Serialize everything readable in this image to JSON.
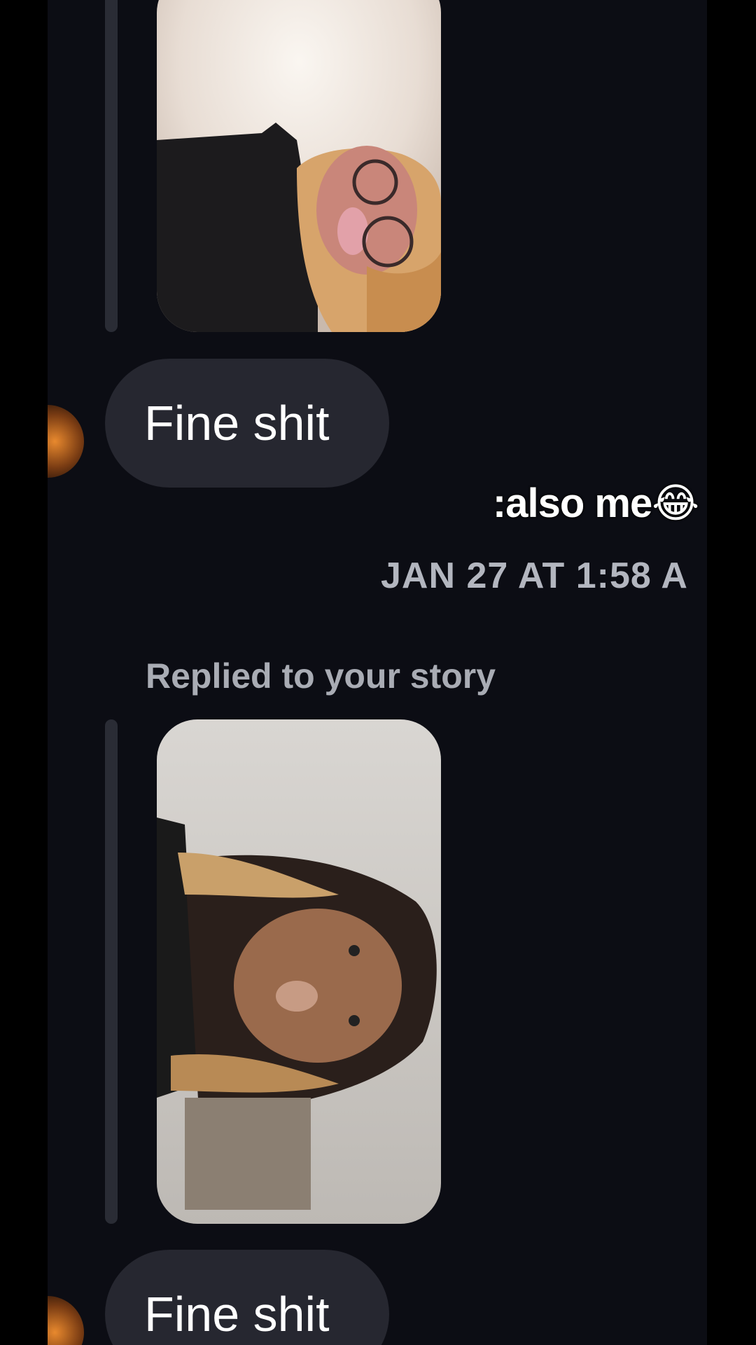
{
  "messages": [
    {
      "story_thumbnail": {
        "description_icon": "story-photo-icon"
      },
      "text": "Fine shit"
    },
    {
      "reply_label": "Replied to your story",
      "story_thumbnail": {
        "description_icon": "story-photo-icon"
      },
      "text": "Fine shit"
    }
  ],
  "overlay_caption": ":also me😂",
  "timestamp": "JAN 27 AT 1:58 A",
  "colors": {
    "background": "#0c0d14",
    "outer": "#000000",
    "bubble": "#262730",
    "reply_bar": "#2a2c35",
    "timestamp_text": "#b3b6bf"
  }
}
